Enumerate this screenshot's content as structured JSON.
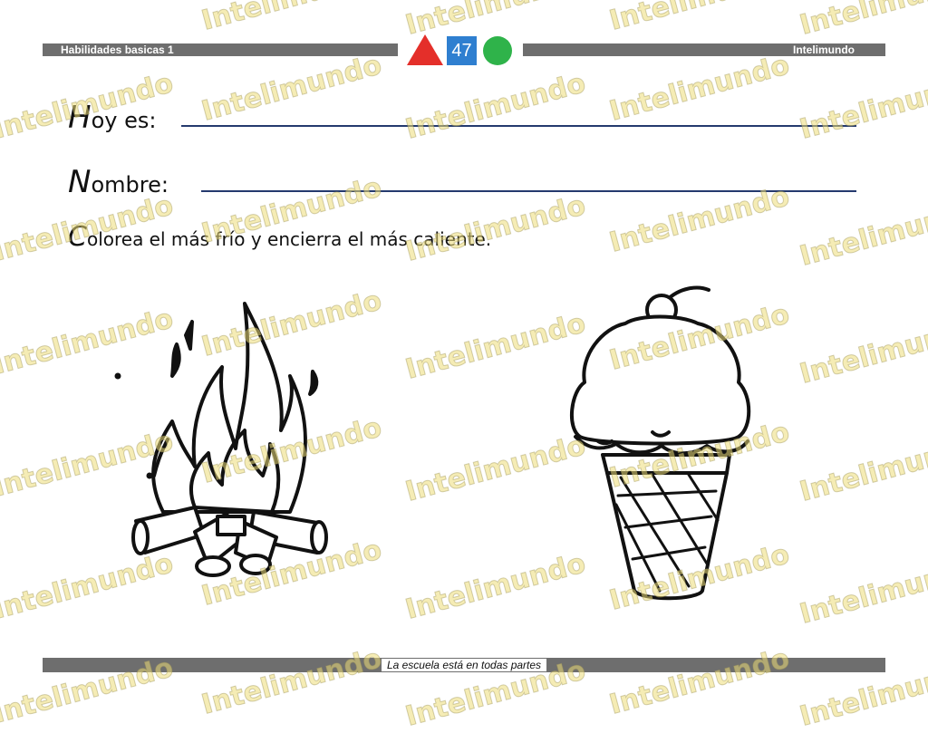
{
  "header": {
    "left_title": "Habilidades basicas 1",
    "page_number": "47",
    "right_title": "Intelimundo"
  },
  "form": {
    "date_label_initial": "H",
    "date_label_rest": "oy es:",
    "name_label_initial": "N",
    "name_label_rest": "ombre:"
  },
  "instruction": {
    "initial": "C",
    "rest": "olorea el más frío y encierra el más caliente."
  },
  "footer": {
    "text": "La escuela está en todas partes"
  },
  "watermark": {
    "text": "Intelimundo"
  },
  "illustrations": {
    "left": "campfire-icon",
    "right": "ice-cream-cone-icon"
  },
  "colors": {
    "header_bar": "#6e6e6e",
    "triangle": "#e42f2a",
    "square": "#2f7fd0",
    "circle": "#2fb34a",
    "rule": "#253a6e",
    "watermark": "#ecdc78"
  }
}
